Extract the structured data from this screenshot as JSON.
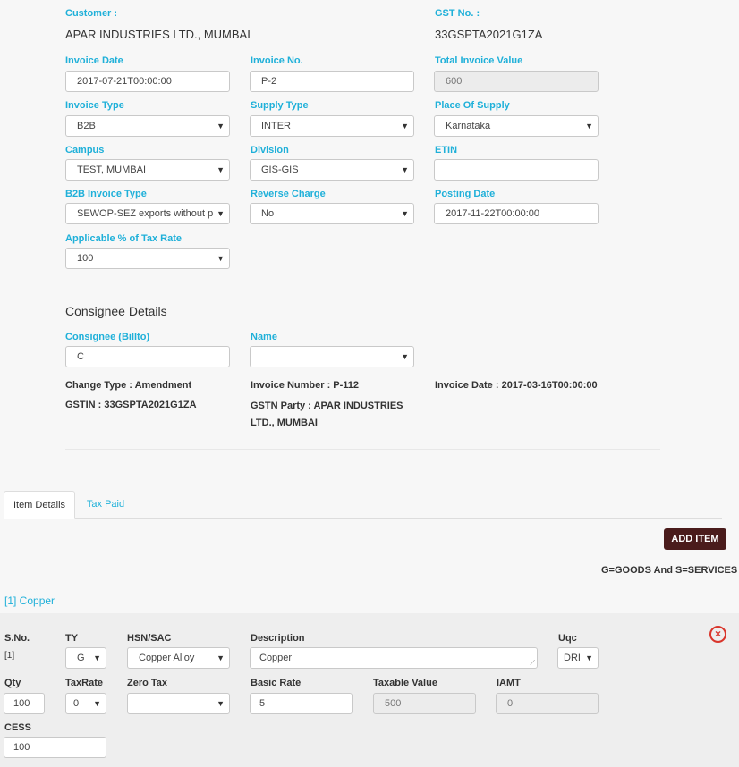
{
  "header": {
    "customer_label": "Customer :",
    "customer_value": "APAR INDUSTRIES LTD., MUMBAI",
    "gst_label": "GST No. :",
    "gst_value": "33GSPTA2021G1ZA"
  },
  "form": {
    "invoice_date": {
      "label": "Invoice Date",
      "value": "2017-07-21T00:00:00"
    },
    "invoice_no": {
      "label": "Invoice No.",
      "value": "P-2"
    },
    "total_invoice_value": {
      "label": "Total Invoice Value",
      "value": "600"
    },
    "invoice_type": {
      "label": "Invoice Type",
      "value": "B2B"
    },
    "supply_type": {
      "label": "Supply Type",
      "value": "INTER"
    },
    "place_of_supply": {
      "label": "Place Of Supply",
      "value": "Karnataka"
    },
    "campus": {
      "label": "Campus",
      "value": "TEST, MUMBAI"
    },
    "division": {
      "label": "Division",
      "value": "GIS-GIS"
    },
    "etin": {
      "label": "ETIN",
      "value": ""
    },
    "b2b_invoice_type": {
      "label": "B2B Invoice Type",
      "value": "SEWOP-SEZ exports without p"
    },
    "reverse_charge": {
      "label": "Reverse Charge",
      "value": "No"
    },
    "posting_date": {
      "label": "Posting Date",
      "value": "2017-11-22T00:00:00"
    },
    "tax_rate_pct": {
      "label": "Applicable % of Tax Rate",
      "value": "100"
    }
  },
  "consignee": {
    "title": "Consignee Details",
    "billto_label": "Consignee (Billto)",
    "billto_value": "C",
    "name_label": "Name",
    "name_value": "",
    "change_type": "Change Type : Amendment",
    "invoice_number": "Invoice Number : P-112",
    "invoice_date": "Invoice Date : 2017-03-16T00:00:00",
    "gstin": "GSTIN : 33GSPTA2021G1ZA",
    "gstn_party_line1": "GSTN Party : APAR INDUSTRIES",
    "gstn_party_line2": "LTD., MUMBAI"
  },
  "tabs": {
    "item_details": "Item Details",
    "tax_paid": "Tax Paid"
  },
  "actions": {
    "add_item": "ADD ITEM",
    "legend": "G=GOODS And S=SERVICES"
  },
  "item": {
    "title": "[1] Copper",
    "sno_label": "S.No.",
    "sno_value": "[1]",
    "ty_label": "TY",
    "ty_value": "G",
    "hsn_label": "HSN/SAC",
    "hsn_value": "Copper Alloy",
    "desc_label": "Description",
    "desc_value": "Copper",
    "uqc_label": "Uqc",
    "uqc_value": "DRI",
    "qty_label": "Qty",
    "qty_value": "100",
    "taxrate_label": "TaxRate",
    "taxrate_value": "0",
    "zerotax_label": "Zero Tax",
    "zerotax_value": "",
    "basicrate_label": "Basic Rate",
    "basicrate_value": "5",
    "taxable_label": "Taxable Value",
    "taxable_value": "500",
    "iamt_label": "IAMT",
    "iamt_value": "0",
    "cess_label": "CESS",
    "cess_value": "100"
  },
  "icons": {
    "dropdown": "caret-down-icon",
    "remove": "close-circle-icon"
  },
  "colors": {
    "label": "#1fb0d9",
    "button": "#4a1c1c",
    "remove": "#d9352b"
  }
}
